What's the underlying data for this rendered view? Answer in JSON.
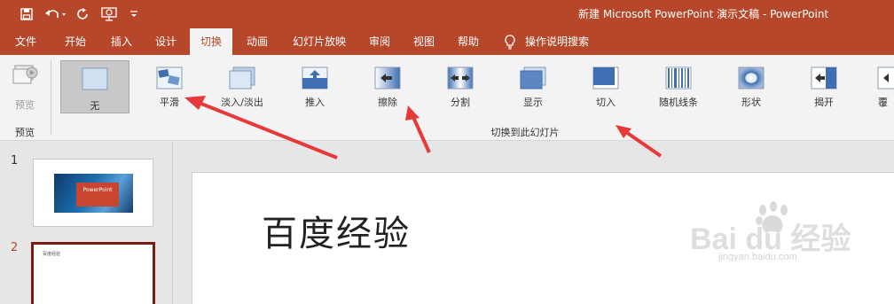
{
  "window": {
    "title": "新建 Microsoft PowerPoint 演示文稿  -  PowerPoint",
    "accent": "#b7472a"
  },
  "quick_access": {
    "save": "save-icon",
    "undo": "undo-icon",
    "redo": "redo-icon",
    "present": "present-from-start-icon",
    "customize": "customize-toolbar-icon"
  },
  "tabs": [
    {
      "label": "文件"
    },
    {
      "label": "开始"
    },
    {
      "label": "插入"
    },
    {
      "label": "设计"
    },
    {
      "label": "切换",
      "active": true
    },
    {
      "label": "动画"
    },
    {
      "label": "幻灯片放映"
    },
    {
      "label": "审阅"
    },
    {
      "label": "视图"
    },
    {
      "label": "帮助"
    },
    {
      "label": "操作说明搜索"
    }
  ],
  "ribbon": {
    "preview": {
      "button_label": "预览",
      "group_label": "预览"
    },
    "transitions_group_label": "切换到此幻灯片",
    "transitions": [
      {
        "label": "无",
        "selected": true
      },
      {
        "label": "平滑"
      },
      {
        "label": "淡入/淡出"
      },
      {
        "label": "推入"
      },
      {
        "label": "擦除"
      },
      {
        "label": "分割"
      },
      {
        "label": "显示"
      },
      {
        "label": "切入"
      },
      {
        "label": "随机线条"
      },
      {
        "label": "形状"
      },
      {
        "label": "揭开"
      },
      {
        "label": "覆"
      }
    ]
  },
  "thumbnails": {
    "slides": [
      {
        "number": "1",
        "title": "PowerPoint"
      },
      {
        "number": "2",
        "title": "百度经验",
        "selected": true
      }
    ]
  },
  "slide": {
    "title": "百度经验"
  },
  "watermark": {
    "brand": "Bai du 经验",
    "url": "jingyan.baidu.com"
  }
}
